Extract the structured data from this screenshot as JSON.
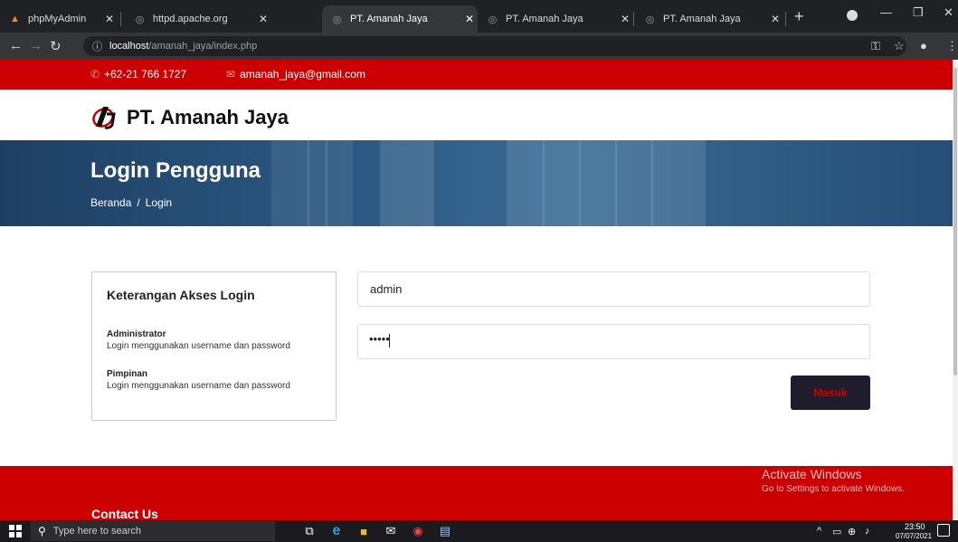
{
  "browser": {
    "tabs": [
      {
        "title": "phpMyAdmin",
        "icon": "phpmyadmin-icon"
      },
      {
        "title": "httpd.apache.org",
        "icon": "globe-icon"
      },
      {
        "title": "PT. Amanah Jaya",
        "icon": "globe-icon",
        "active": true
      },
      {
        "title": "PT. Amanah Jaya",
        "icon": "globe-icon"
      },
      {
        "title": "PT. Amanah Jaya",
        "icon": "globe-icon"
      }
    ],
    "address": {
      "host": "localhost",
      "path": "/amanah_jaya/index.php"
    }
  },
  "topbar": {
    "phone": "+62-21 766 1727",
    "email": "amanah_jaya@gmail.com"
  },
  "header": {
    "brand": "PT. Amanah Jaya"
  },
  "hero": {
    "title": "Login Pengguna",
    "breadcrumb": [
      "Beranda",
      "/",
      "Login"
    ]
  },
  "info": {
    "title": "Keterangan Akses Login",
    "roles": [
      {
        "name": "Administrator",
        "desc": "Login menggunakan username dan password"
      },
      {
        "name": "Pimpinan",
        "desc": "Login menggunakan username dan password"
      }
    ]
  },
  "form": {
    "username": "admin",
    "password_mask": "•••••",
    "submit_label": "Masuk"
  },
  "footer": {
    "title": "Contact Us"
  },
  "watermark": {
    "line1": "Activate Windows",
    "line2": "Go to Settings to activate Windows."
  },
  "taskbar": {
    "search_placeholder": "Type here to search",
    "time": "23:50",
    "date": "07/07/2021"
  },
  "colors": {
    "brand_red": "#cc0000",
    "dark_button": "#1f1d2b",
    "hero_blue": "#2d5b85"
  }
}
